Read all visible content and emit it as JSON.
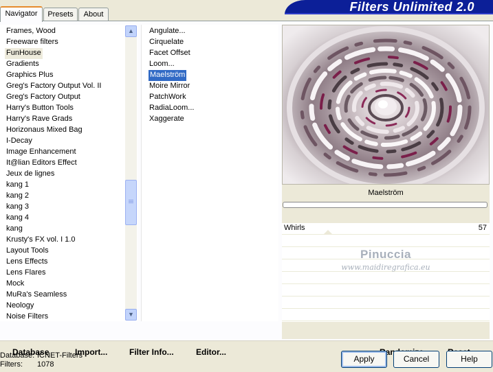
{
  "tabs": [
    {
      "label": "Navigator"
    },
    {
      "label": "Presets"
    },
    {
      "label": "About"
    }
  ],
  "app_title": "Filters Unlimited 2.0",
  "categories": [
    {
      "label": "Frames, Wood"
    },
    {
      "label": "Freeware filters"
    },
    {
      "label": "FunHouse"
    },
    {
      "label": "Gradients"
    },
    {
      "label": "Graphics Plus"
    },
    {
      "label": "Greg's Factory Output Vol. II"
    },
    {
      "label": "Greg's Factory Output"
    },
    {
      "label": "Harry's Button Tools"
    },
    {
      "label": "Harry's Rave Grads"
    },
    {
      "label": "Horizonaus Mixed Bag"
    },
    {
      "label": "I-Decay"
    },
    {
      "label": "Image Enhancement"
    },
    {
      "label": "It@lian Editors Effect"
    },
    {
      "label": "Jeux de lignes"
    },
    {
      "label": "kang 1"
    },
    {
      "label": "kang 2"
    },
    {
      "label": "kang 3"
    },
    {
      "label": "kang 4"
    },
    {
      "label": "kang"
    },
    {
      "label": "Krusty's FX vol. I 1.0"
    },
    {
      "label": "Layout Tools"
    },
    {
      "label": "Lens Effects"
    },
    {
      "label": "Lens Flares"
    },
    {
      "label": "Mock"
    },
    {
      "label": "MuRa's Seamless"
    },
    {
      "label": "Neology"
    },
    {
      "label": "Noise Filters"
    }
  ],
  "selected_category": "FunHouse",
  "filters": [
    {
      "label": "Angulate..."
    },
    {
      "label": "Cirquelate"
    },
    {
      "label": "Facet Offset"
    },
    {
      "label": "Loom..."
    },
    {
      "label": "Maelström"
    },
    {
      "label": "Moire Mirror"
    },
    {
      "label": "PatchWork"
    },
    {
      "label": "RadiaLoom..."
    },
    {
      "label": "Xaggerate"
    }
  ],
  "selected_filter": "Maelström",
  "preview": {
    "filter_name": "Maelström",
    "param": {
      "label": "Whirls",
      "value": "57"
    },
    "watermark_line1": "Pinuccia",
    "watermark_line2": "www.maidiregrafica.eu"
  },
  "toolbar": {
    "database": "Database",
    "import": "Import...",
    "filter_info": "Filter Info...",
    "editor": "Editor...",
    "randomize": "Randomize",
    "reset": "Reset"
  },
  "footer": {
    "database_label": "Database:",
    "database_value": "ICNET-Filters",
    "filters_label": "Filters:",
    "filters_value": "1078"
  },
  "buttons": {
    "apply": "Apply",
    "cancel": "Cancel",
    "help": "Help"
  },
  "scroll": {
    "position": 0.62
  }
}
